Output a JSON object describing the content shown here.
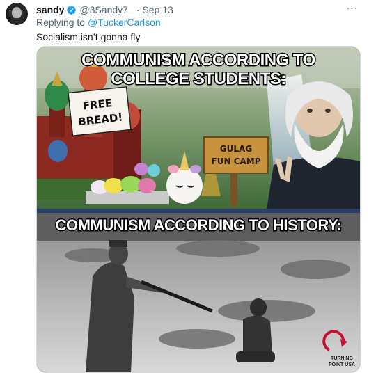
{
  "tweet": {
    "author_name": "sandy",
    "handle": "@3Sandy7_",
    "separator": "·",
    "date": "Sep 13",
    "replying_prefix": "Replying to ",
    "replying_to": "@TuckerCarlson",
    "text": "Socialism isn’t gonna fly",
    "more_label": "···"
  },
  "media": {
    "caption_top_line1": "COMMUNISM ACCORDING TO",
    "caption_top_line2": "COLLEGE STUDENTS:",
    "sign_line1": "FREE",
    "sign_line2": "BREAD!",
    "wood_line1": "GULAG",
    "wood_line2": "FUN CAMP",
    "caption_bottom": "COMMUNISM ACCORDING TO HISTORY:",
    "logo_line1": "TURNING",
    "logo_line2": "POINT USA"
  },
  "icons": {
    "verified": "verified-badge-icon",
    "more": "more-horizontal-icon"
  },
  "colors": {
    "link": "#1d9bf0",
    "secondary_text": "#536471",
    "verified": "#1d9bf0",
    "logo_red": "#c8102e"
  }
}
